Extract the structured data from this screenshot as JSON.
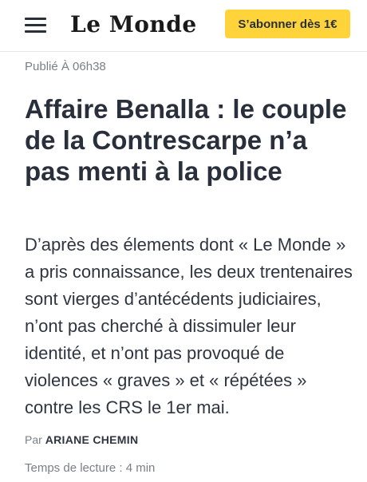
{
  "header": {
    "logo_text": "Le Monde",
    "subscribe_label": "S’abonner dès 1€"
  },
  "article": {
    "published": "Publié À 06h38",
    "headline": "Affaire Benalla : le couple de la Contrescarpe n’a pas menti à la police",
    "summary": "D’après des élements dont « Le Monde » a pris connaissance, les deux trentenaires sont vierges d’antécédents judiciaires, n’ont pas cherché à dissimuler leur identité, et n’ont pas provoqué de violences « graves » et « répétées » contre les CRS le 1er mai.",
    "byline_prefix": "Par",
    "author": "ARIANE CHEMIN",
    "reading_time": "Temps de lecture : 4 min"
  },
  "colors": {
    "subscribe_bg": "#ffd43b",
    "text": "#2a303b",
    "muted": "#7a7f87"
  }
}
